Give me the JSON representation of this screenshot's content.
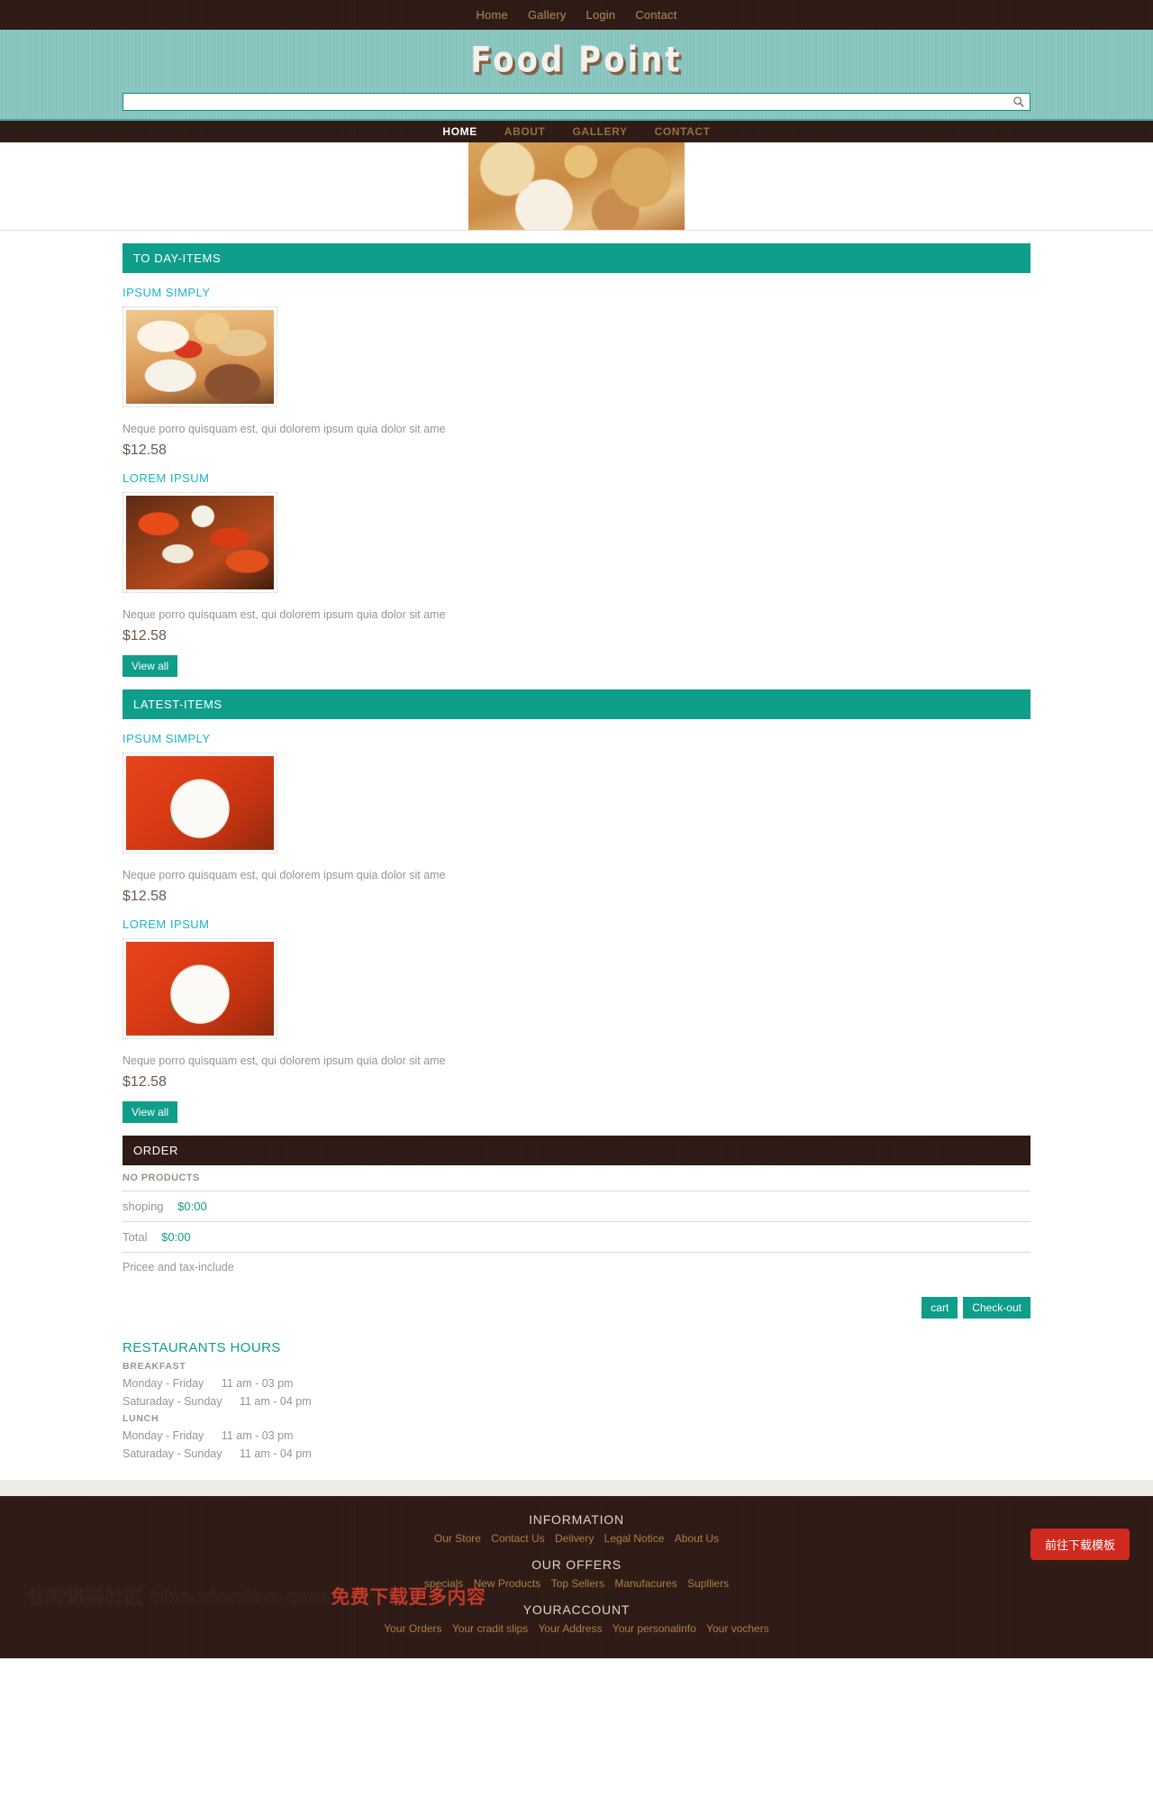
{
  "topbar": {
    "links": [
      {
        "label": "Home"
      },
      {
        "label": "Gallery"
      },
      {
        "label": "Login"
      },
      {
        "label": "Contact"
      }
    ]
  },
  "brand": {
    "logo_text": "Food Point"
  },
  "search": {
    "value": "",
    "placeholder": "",
    "icon": "search-icon"
  },
  "mainnav": {
    "items": [
      {
        "label": "HOME",
        "active": true
      },
      {
        "label": "ABOUT",
        "active": false
      },
      {
        "label": "GALLERY",
        "active": false
      },
      {
        "label": "CONTACT",
        "active": false
      }
    ]
  },
  "sections": [
    {
      "heading": "TO DAY-ITEMS",
      "view_all_label": "View all",
      "products": [
        {
          "title": "IPSUM SIMPLY",
          "desc": "Neque porro quisquam est, qui dolorem ipsum quia dolor sit ame",
          "price": "$12.58",
          "image": "pastry-photo"
        },
        {
          "title": "LOREM IPSUM",
          "desc": "Neque porro quisquam est, qui dolorem ipsum quia dolor sit ame",
          "price": "$12.58",
          "image": "peppers-photo"
        }
      ]
    },
    {
      "heading": "LATEST-ITEMS",
      "view_all_label": "View all",
      "products": [
        {
          "title": "IPSUM SIMPLY",
          "desc": "Neque porro quisquam est, qui dolorem ipsum quia dolor sit ame",
          "price": "$12.58",
          "image": "plate-photo"
        },
        {
          "title": "LOREM IPSUM",
          "desc": "Neque porro quisquam est, qui dolorem ipsum quia dolor sit ame",
          "price": "$12.58",
          "image": "plate-photo"
        }
      ]
    }
  ],
  "order": {
    "heading": "ORDER",
    "empty_label": "NO PRODUCTS",
    "shipping_label": "shoping",
    "shipping_amount": "$0:00",
    "total_label": "Total",
    "total_amount": "$0:00",
    "tax_note": "Pricee and tax-include",
    "cart_label": "cart",
    "checkout_label": "Check-out"
  },
  "hours": {
    "title": "RESTAURANTS HOURS",
    "groups": [
      {
        "name": "BREAKFAST",
        "rows": [
          {
            "days": "Monday - Friday",
            "time": "11 am - 03 pm"
          },
          {
            "days": "Saturaday - Sunday",
            "time": "11 am - 04 pm"
          }
        ]
      },
      {
        "name": "LUNCH",
        "rows": [
          {
            "days": "Monday - Friday",
            "time": "11 am - 03 pm"
          },
          {
            "days": "Saturaday - Sunday",
            "time": "11 am - 04 pm"
          }
        ]
      }
    ]
  },
  "footer": {
    "columns": [
      {
        "heading": "INFORMATION",
        "links": [
          "Our Store",
          "Contact Us",
          "Delivery",
          "Legal Notice",
          "About Us"
        ]
      },
      {
        "heading": "OUR OFFERS",
        "links": [
          "specials",
          "New Products",
          "Top Sellers",
          "Manufacures",
          "Suplliers"
        ]
      },
      {
        "heading": "YOURACCOUNT",
        "links": [
          "Your Orders",
          "Your cradit slips",
          "Your Address",
          "Your personalinfo",
          "Your vochers"
        ]
      }
    ]
  },
  "overlay": {
    "download_button": "前往下载模板",
    "watermark_prefix": "访问",
    "watermark_site": "源码社区 bbs.xienlao.com",
    "watermark_suffix": "免费下载更多内容"
  },
  "colors": {
    "teal": "#0f9e8a",
    "banner_teal": "#87c3bd",
    "dark_brown": "#2e1a14",
    "link_gold": "#a97f46",
    "title_cyan": "#1ab5c6"
  }
}
